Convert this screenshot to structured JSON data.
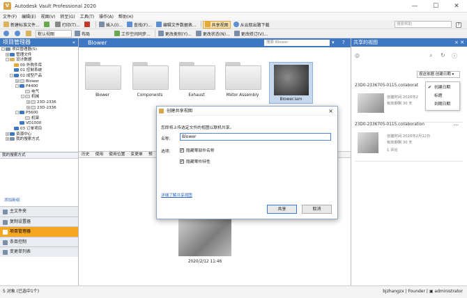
{
  "window": {
    "title": "Autodesk Vault Professional 2020",
    "controls": [
      "—",
      "☐",
      "✕"
    ]
  },
  "menu": [
    "文件(F)",
    "编辑(E)",
    "视图(V)",
    "转至(G)",
    "工具(T)",
    "操作(A)",
    "帮助(H)"
  ],
  "toolbar1": {
    "items": [
      "新建标准文件...",
      "打印(T)...",
      "插入(I)...",
      "查找(F)...",
      "编辑文件数据表...",
      "共享视图",
      "从云取出路下载"
    ],
    "search_placeholder": "搜索帮助"
  },
  "toolbar2": {
    "view_label": "默认视图",
    "layout_label": "布局",
    "items": [
      "工作空间同步...",
      "更改类别(Y)...",
      "更改状态(N)...",
      "更改修订(V)..."
    ]
  },
  "left": {
    "title": "项目管理器",
    "tree": [
      {
        "label": "项目管理器(S)",
        "level": 0
      },
      {
        "label": "管理文件",
        "level": 1
      },
      {
        "label": "设计数据",
        "level": 1
      },
      {
        "label": "00 外购件库",
        "level": 2
      },
      {
        "label": "01 控制系统",
        "level": 2
      },
      {
        "label": "02 成型产品",
        "level": 2
      },
      {
        "label": "Blower",
        "level": 3
      },
      {
        "label": "P4400",
        "level": 3
      },
      {
        "label": "电气",
        "level": 4
      },
      {
        "label": "机械",
        "level": 4
      },
      {
        "label": "23D-2336",
        "level": 5
      },
      {
        "label": "23D-2336",
        "level": 5
      },
      {
        "label": "P5600",
        "level": 3
      },
      {
        "label": "机架",
        "level": 4
      },
      {
        "label": "VD1000",
        "level": 3
      },
      {
        "label": "03 订单项目",
        "level": 2
      },
      {
        "label": "资源中心",
        "level": 1
      },
      {
        "label": "我的搜索方式",
        "level": 1
      }
    ],
    "subtab": "我的搜索方式",
    "add_link": "添加新组",
    "nav": [
      "主文件夹",
      "复制设置器",
      "项目管理器",
      "条目控制",
      "变更单列表"
    ],
    "active_nav": 2
  },
  "center": {
    "title": "Blower",
    "search_placeholder": "搜索 Blower",
    "folders": [
      "Blower",
      "Components",
      "Exhaust",
      "Motor Assembly"
    ],
    "selected_file": "Blower.iam",
    "tabs": [
      "历史",
      "使用",
      "使用位置",
      "变更单",
      "预"
    ],
    "preview_timestamp": "2020/2/12 11:46"
  },
  "right": {
    "title": "共享的视图",
    "sort_label": "按这依据 创建日期 ▾",
    "sort_options": [
      "创建日期",
      "标题",
      "到期日期"
    ],
    "cards": [
      {
        "name": "23D0-2336705-0115.collaborat",
        "created": "创建时间 2020年2",
        "expires": "有效期剩 30 天"
      },
      {
        "name": "23D0-2336705-0115.collaboration",
        "created": "创建时间 2020年2月12日",
        "expires": "有效期剩 30 天",
        "comments": "1 评论"
      }
    ]
  },
  "status": {
    "count": "5 对象 (已选中1个)",
    "user": "bjzhangzx",
    "vault": "Founder",
    "role": "administrator"
  },
  "dialog": {
    "title": "创建共享视图",
    "description": "您即将上传选定文件的视图以联机共享。",
    "name_label": "名称:",
    "name_value": "Blower",
    "options_label": "选项:",
    "option1": "隐藏零部件名称",
    "option2": "隐藏零件特性",
    "link": "详细了解共享视图",
    "share": "共享",
    "cancel": "取消"
  },
  "colors": {
    "accent": "#3f78c2",
    "active_nav": "#f5a623",
    "dialog_border": "#8fa7c7"
  }
}
